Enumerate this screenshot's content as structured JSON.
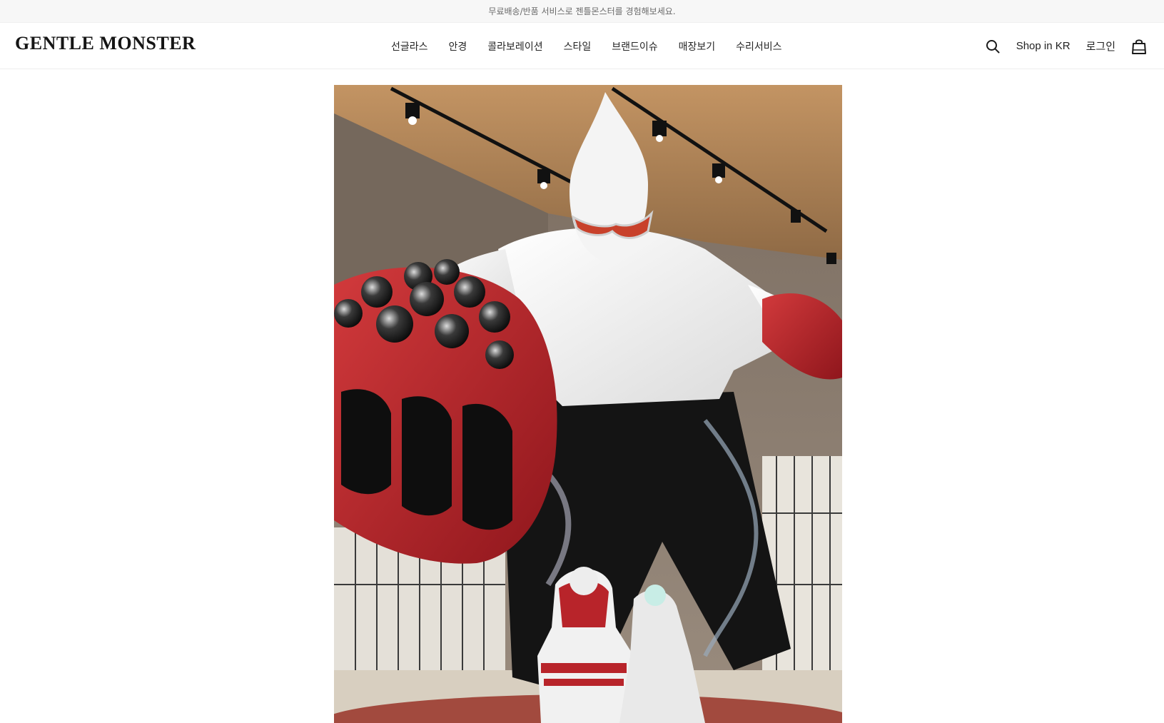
{
  "announcement": "무료배송/반품 서비스로 젠틀몬스터를 경험해보세요.",
  "brand": {
    "logo_text": "GENTLE MONSTER"
  },
  "nav": {
    "items": [
      {
        "label": "선글라스"
      },
      {
        "label": "안경"
      },
      {
        "label": "콜라보레이션"
      },
      {
        "label": "스타일"
      },
      {
        "label": "브랜드이슈"
      },
      {
        "label": "매장보기"
      },
      {
        "label": "수리서비스"
      }
    ]
  },
  "tools": {
    "search_icon": "search-icon",
    "shop_label": "Shop in KR",
    "login_label": "로그인",
    "cart_icon": "shopping-bag-icon"
  },
  "hero": {
    "description": "hero-image",
    "colors": {
      "ceiling": "#b88a5a",
      "wall": "#8c7a6a",
      "figure": "#f2f2f2",
      "glove": "#b8242a",
      "pants": "#151515",
      "floor": "#a24a3e"
    }
  }
}
